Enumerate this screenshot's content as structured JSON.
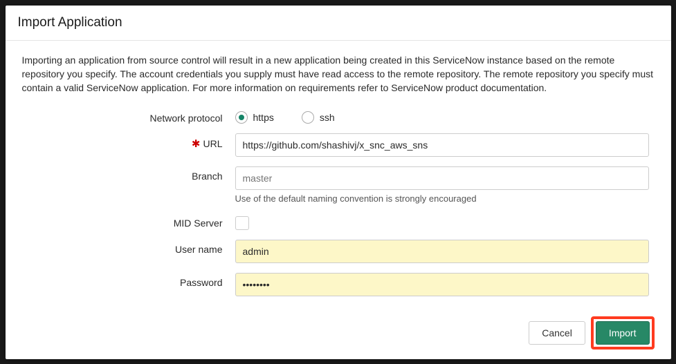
{
  "modal": {
    "title": "Import Application",
    "description": "Importing an application from source control will result in a new application being created in this ServiceNow instance based on the remote repository you specify. The account credentials you supply must have read access to the remote repository. The remote repository you specify must contain a valid ServiceNow application. For more information on requirements refer to ServiceNow product documentation."
  },
  "form": {
    "network_protocol": {
      "label": "Network protocol",
      "options": {
        "https": "https",
        "ssh": "ssh"
      },
      "selected": "https"
    },
    "url": {
      "label": "URL",
      "value": "https://github.com/shashivj/x_snc_aws_sns"
    },
    "branch": {
      "label": "Branch",
      "placeholder": "master",
      "value": "",
      "help": "Use of the default naming convention is strongly encouraged"
    },
    "mid_server": {
      "label": "MID Server",
      "checked": false
    },
    "user_name": {
      "label": "User name",
      "value": "admin"
    },
    "password": {
      "label": "Password",
      "value": "••••••••"
    }
  },
  "buttons": {
    "cancel": "Cancel",
    "import": "Import"
  },
  "colors": {
    "primary": "#278866",
    "highlight": "#ff3b1f",
    "autofill_bg": "#fdf7c8"
  }
}
